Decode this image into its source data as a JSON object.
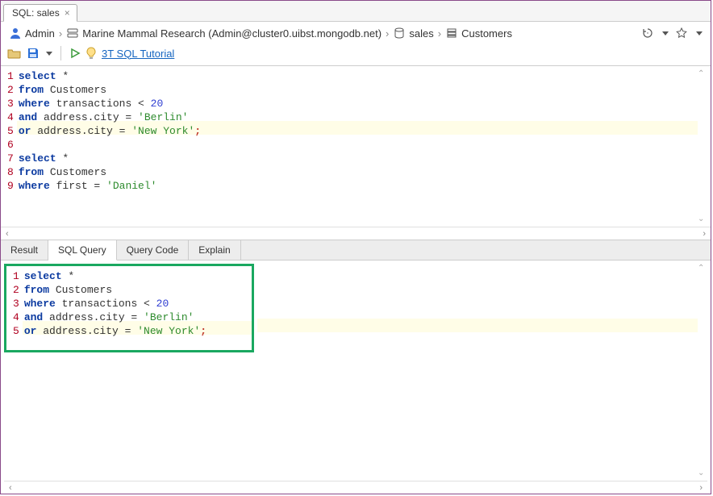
{
  "tab": {
    "title": "SQL: sales"
  },
  "breadcrumb": {
    "user": "Admin",
    "connection": "Marine Mammal Research (Admin@cluster0.uibst.mongodb.net)",
    "database": "sales",
    "collection": "Customers"
  },
  "toolbar": {
    "tutorial_label": "3T SQL Tutorial"
  },
  "editor": {
    "highlight_line": 5,
    "lines": [
      [
        {
          "t": "select",
          "c": "kw"
        },
        {
          "t": " *"
        }
      ],
      [
        {
          "t": "from",
          "c": "kw"
        },
        {
          "t": " Customers"
        }
      ],
      [
        {
          "t": "where",
          "c": "kw"
        },
        {
          "t": " transactions < "
        },
        {
          "t": "20",
          "c": "num"
        }
      ],
      [
        {
          "t": "and",
          "c": "kw"
        },
        {
          "t": " address.city = "
        },
        {
          "t": "'Berlin'",
          "c": "str"
        }
      ],
      [
        {
          "t": "or",
          "c": "kw"
        },
        {
          "t": " address.city = "
        },
        {
          "t": "'New York'",
          "c": "str"
        },
        {
          "t": ";",
          "c": "punct"
        }
      ],
      [],
      [
        {
          "t": "select",
          "c": "kw"
        },
        {
          "t": " *"
        }
      ],
      [
        {
          "t": "from",
          "c": "kw"
        },
        {
          "t": " Customers"
        }
      ],
      [
        {
          "t": "where",
          "c": "kw"
        },
        {
          "t": " first = "
        },
        {
          "t": "'Daniel'",
          "c": "str"
        }
      ]
    ]
  },
  "result_tabs": {
    "items": [
      "Result",
      "SQL Query",
      "Query Code",
      "Explain"
    ],
    "active_index": 1
  },
  "result_editor": {
    "highlight_line": 5,
    "lines": [
      [
        {
          "t": "select",
          "c": "kw"
        },
        {
          "t": " *"
        }
      ],
      [
        {
          "t": "from",
          "c": "kw"
        },
        {
          "t": " Customers"
        }
      ],
      [
        {
          "t": "where",
          "c": "kw"
        },
        {
          "t": " transactions < "
        },
        {
          "t": "20",
          "c": "num"
        }
      ],
      [
        {
          "t": "and",
          "c": "kw"
        },
        {
          "t": " address.city = "
        },
        {
          "t": "'Berlin'",
          "c": "str"
        }
      ],
      [
        {
          "t": "or",
          "c": "kw"
        },
        {
          "t": " address.city = "
        },
        {
          "t": "'New York'",
          "c": "str"
        },
        {
          "t": ";",
          "c": "punct"
        }
      ]
    ]
  }
}
